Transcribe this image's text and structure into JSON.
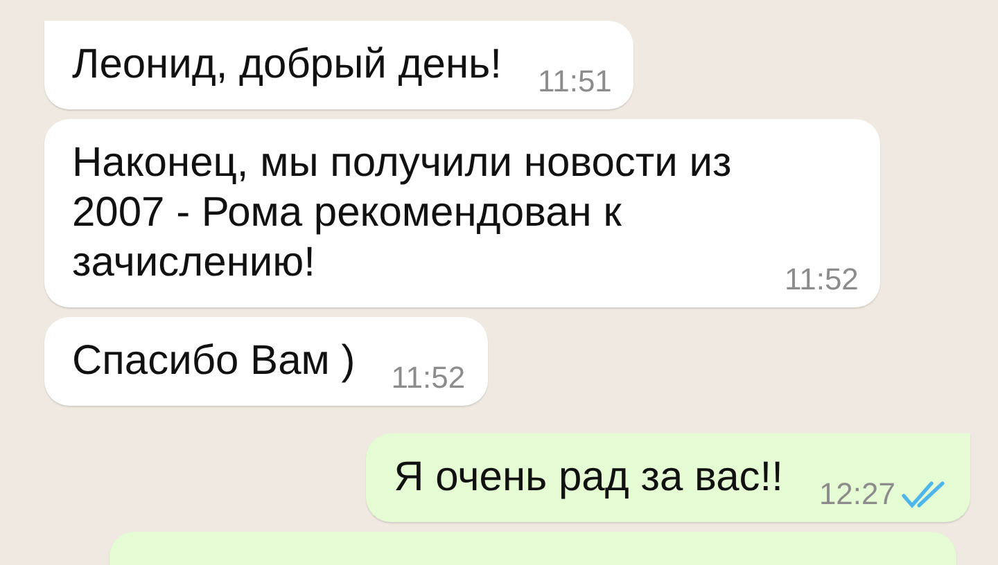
{
  "messages": [
    {
      "kind": "incoming",
      "text": "Леонид, добрый день!",
      "time": "11:51"
    },
    {
      "kind": "incoming",
      "text": "Наконец, мы получили новости из 2007 - Рома рекомендован к зачислению!",
      "time": "11:52"
    },
    {
      "kind": "incoming",
      "text": "Спасибо Вам )",
      "time": "11:52"
    },
    {
      "kind": "outgoing",
      "text": "Я очень рад за вас!!",
      "time": "12:27",
      "read": true
    }
  ]
}
